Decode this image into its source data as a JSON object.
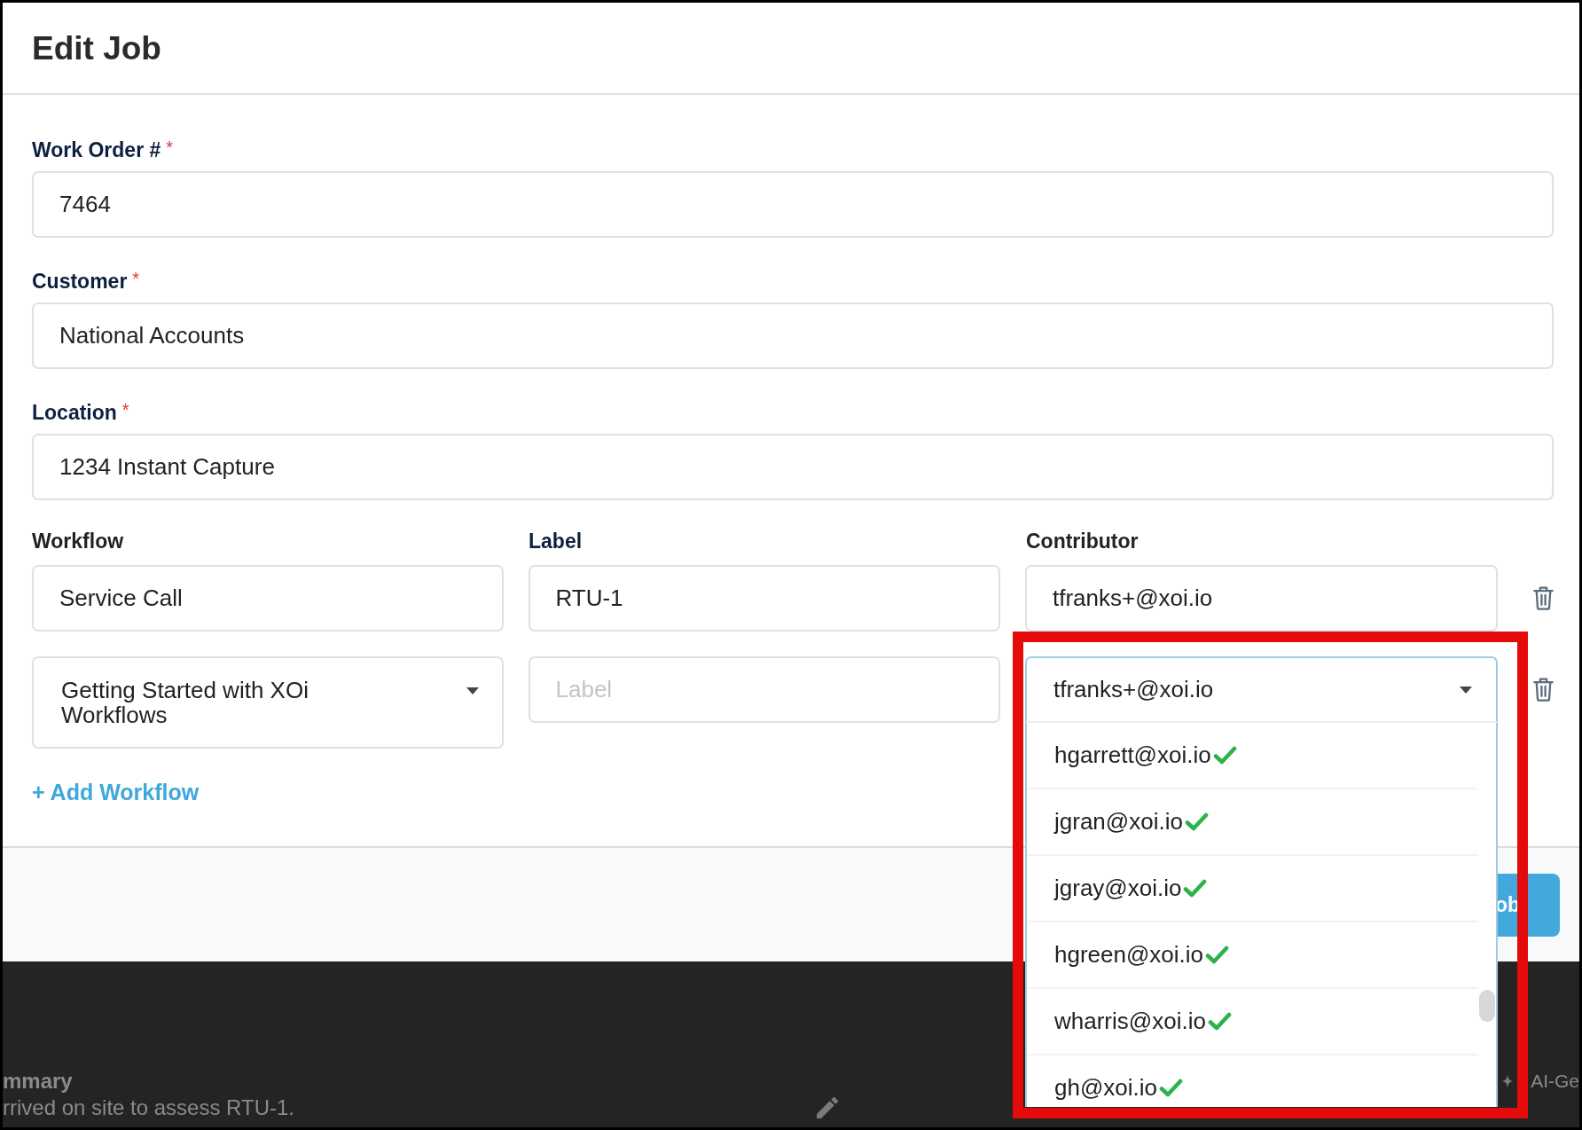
{
  "dialog": {
    "title": "Edit Job"
  },
  "fields": [
    {
      "label": "Work Order #",
      "required_mark": "*",
      "value": "7464"
    },
    {
      "label": "Customer",
      "required_mark": "*",
      "value": "National Accounts"
    },
    {
      "label": "Location",
      "required_mark": "*",
      "value": "1234 Instant Capture"
    }
  ],
  "workflows": {
    "columns": [
      "Workflow",
      "Label",
      "Contributor"
    ],
    "rows": [
      {
        "workflow": {
          "kind": "text",
          "value": "Service Call"
        },
        "label": {
          "value": "RTU-1"
        },
        "contributor": {
          "kind": "text",
          "value": "tfranks+@xoi.io",
          "expanded": false,
          "highlighted": false
        }
      },
      {
        "workflow": {
          "kind": "select",
          "value": "Getting Started with XOi Workflows"
        },
        "label": {
          "placeholder": "Label"
        },
        "contributor": {
          "kind": "select",
          "value": "tfranks+@xoi.io",
          "expanded": true,
          "highlighted": true,
          "options": [
            {
              "label": "hgarrett@xoi.io",
              "checked": true
            },
            {
              "label": "jgran@xoi.io",
              "checked": true
            },
            {
              "label": "jgray@xoi.io",
              "checked": true
            },
            {
              "label": "hgreen@xoi.io",
              "checked": true
            },
            {
              "label": "wharris@xoi.io",
              "checked": true
            },
            {
              "label": "gh@xoi.io",
              "checked": true
            }
          ]
        }
      }
    ],
    "add_link": "+ Add Workflow"
  },
  "footer": {
    "primary_button": "ob"
  },
  "background_page": {
    "heading": "mmary",
    "text": "rrived on site to assess RTU-1.",
    "side_text": "AI-Ge"
  }
}
